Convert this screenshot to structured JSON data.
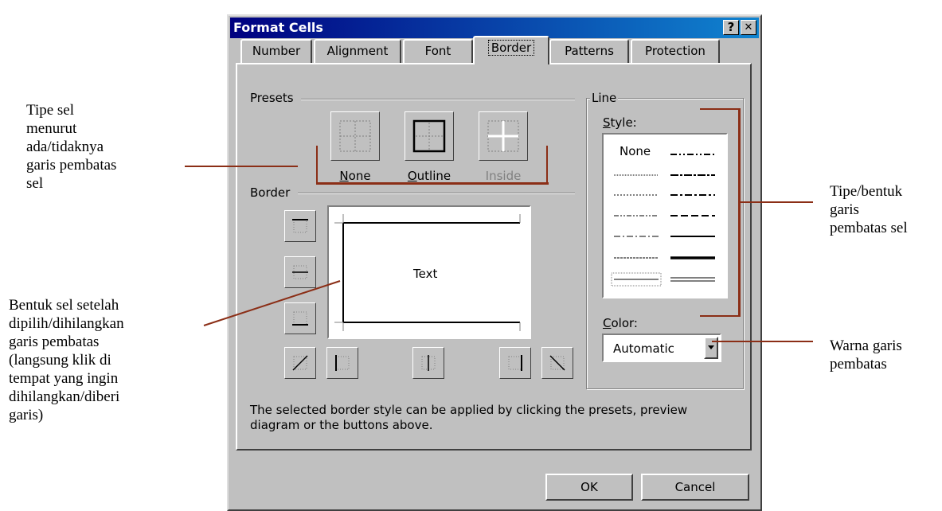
{
  "dialog": {
    "title": "Format Cells",
    "help_label": "?",
    "close_label": "✕"
  },
  "tabs": [
    {
      "label": "Number"
    },
    {
      "label": "Alignment"
    },
    {
      "label": "Font"
    },
    {
      "label": "Border",
      "active": true
    },
    {
      "label": "Patterns"
    },
    {
      "label": "Protection"
    }
  ],
  "presets": {
    "heading": "Presets",
    "none": {
      "u": "N",
      "rest": "one"
    },
    "outline": {
      "u": "O",
      "rest": "utline"
    },
    "inside": {
      "label": "Inside",
      "disabled": true
    }
  },
  "border": {
    "heading": "Border",
    "preview_text": "Text"
  },
  "line": {
    "heading": "Line",
    "style_label": {
      "u": "S",
      "rest": "tyle:"
    },
    "style_none": "None",
    "color_label": {
      "u": "C",
      "rest": "olor:"
    },
    "color_value": "Automatic"
  },
  "hint": {
    "line1": "The selected border style can be applied by clicking the presets, preview",
    "line2": "diagram or the buttons above."
  },
  "buttons": {
    "ok": "OK",
    "cancel": "Cancel"
  },
  "annotations": {
    "presets": [
      "Tipe sel",
      "menurut",
      "ada/tidaknya",
      "garis pembatas",
      "sel"
    ],
    "border": [
      "Bentuk sel setelah",
      "dipilih/dihilangkan",
      "garis pembatas",
      "(langsung klik di",
      "tempat yang ingin",
      "dihilangkan/diberi",
      "garis)"
    ],
    "style": [
      "Tipe/bentuk",
      "garis",
      "pembatas sel"
    ],
    "color": [
      "Warna garis",
      "pembatas"
    ]
  },
  "colors": {
    "annotation_line": "#8b2e16",
    "titlebar": "#000080"
  }
}
